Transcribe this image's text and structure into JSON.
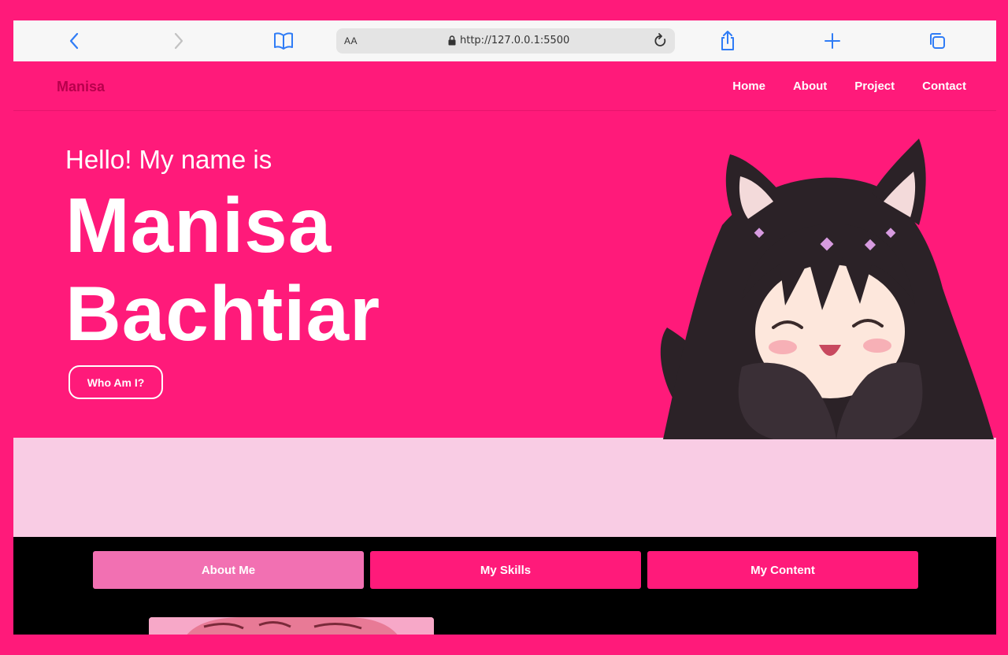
{
  "browser": {
    "aa_label": "AA",
    "url": "http://127.0.0.1:5500",
    "icons": [
      "chevron-left-icon",
      "chevron-right-icon",
      "book-icon",
      "lock-icon",
      "reload-icon",
      "share-icon",
      "plus-icon",
      "tabs-icon"
    ]
  },
  "nav": {
    "brand": "Manisa",
    "links": [
      "Home",
      "About",
      "Project",
      "Contact"
    ]
  },
  "hero": {
    "greeting": "Hello! My name is",
    "first_name": "Manisa",
    "last_name": "Bachtiar",
    "button": "Who Am I?"
  },
  "tabs": [
    "About Me",
    "My Skills",
    "My Content"
  ],
  "colors": {
    "accent": "#ff1a7a",
    "brand_text": "#b8004c",
    "band": "#f9cce4",
    "active_tab": "#f270b2",
    "dark": "#000000",
    "browser_blue": "#2f7cf6"
  }
}
